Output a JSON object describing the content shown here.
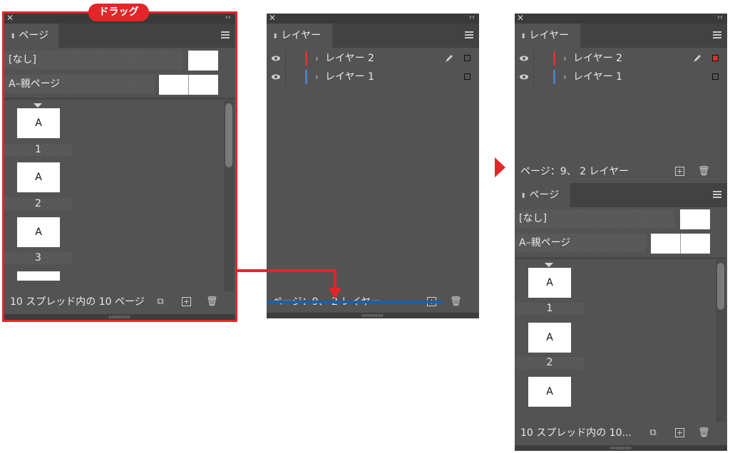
{
  "drag_label": "ドラッグ",
  "colors": {
    "accent_red": "#e2262a",
    "drop_line": "#1e5fa8",
    "layer_red": "#e03030",
    "layer_blue": "#4a7fc8"
  },
  "left_panel": {
    "tab": "ページ",
    "master_none": "[なし]",
    "master_a": "A–親ページ",
    "pages": [
      {
        "label": "A",
        "num": "1"
      },
      {
        "label": "A",
        "num": "2"
      },
      {
        "label": "A",
        "num": "3"
      }
    ],
    "footer": "10 スプレッド内の 10 ページ"
  },
  "middle_panel": {
    "tab": "レイヤー",
    "layers": [
      {
        "name": "レイヤー 2",
        "color": "#e03030"
      },
      {
        "name": "レイヤー 1",
        "color": "#4a7fc8"
      }
    ],
    "footer": "ページ：9、 2 レイヤー"
  },
  "right_panel": {
    "layers_tab": "レイヤー",
    "layers": [
      {
        "name": "レイヤー 2",
        "color": "#e03030"
      },
      {
        "name": "レイヤー 1",
        "color": "#4a7fc8"
      }
    ],
    "layers_footer": "ページ：9、 2 レイヤー",
    "pages_tab": "ページ",
    "master_none": "[なし]",
    "master_a": "A–親ページ",
    "pages": [
      {
        "label": "A",
        "num": "1"
      },
      {
        "label": "A",
        "num": "2"
      },
      {
        "label": "A"
      }
    ],
    "pages_footer": "10 スプレッド内の 10..."
  },
  "icons": [
    "close-icon",
    "collapse-icon",
    "panel-menu-icon",
    "eye-icon",
    "pen-icon",
    "new-page-icon",
    "new-layer-icon",
    "trash-icon",
    "edit-pages-icon",
    "arrow-right-icon"
  ]
}
